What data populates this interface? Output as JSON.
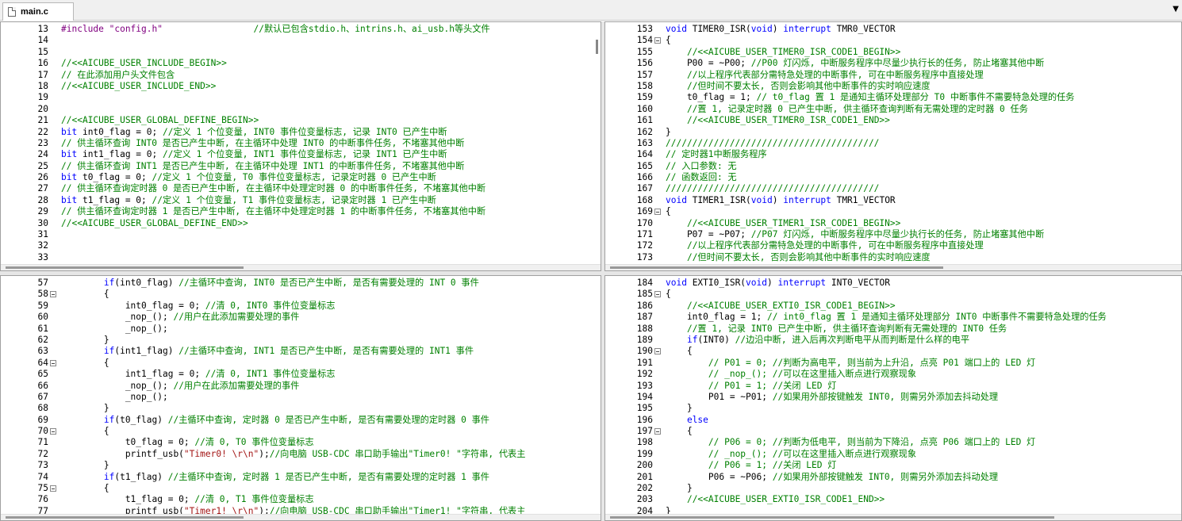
{
  "tab": {
    "label": "main.c"
  },
  "dropdown_glyph": "▼",
  "panes": [
    {
      "name": "pane-top-left",
      "lines": [
        {
          "n": "13",
          "segs": [
            [
              "pp",
              "#include \"config.h\""
            ],
            [
              "tx",
              "                 "
            ],
            [
              "cm",
              "//默认已包含stdio.h、intrins.h、ai_usb.h等头文件"
            ]
          ]
        },
        {
          "n": "14",
          "segs": []
        },
        {
          "n": "15",
          "segs": []
        },
        {
          "n": "16",
          "segs": [
            [
              "cm",
              "//<<AICUBE_USER_INCLUDE_BEGIN>>"
            ]
          ]
        },
        {
          "n": "17",
          "segs": [
            [
              "cm",
              "// 在此添加用户头文件包含"
            ]
          ]
        },
        {
          "n": "18",
          "segs": [
            [
              "cm",
              "//<<AICUBE_USER_INCLUDE_END>>"
            ]
          ]
        },
        {
          "n": "19",
          "segs": []
        },
        {
          "n": "20",
          "segs": []
        },
        {
          "n": "21",
          "segs": [
            [
              "cm",
              "//<<AICUBE_USER_GLOBAL_DEFINE_BEGIN>>"
            ]
          ]
        },
        {
          "n": "22",
          "segs": [
            [
              "kw",
              "bit"
            ],
            [
              "tx",
              " int0_flag = 0; "
            ],
            [
              "cm",
              "//定义 1 个位变量, INT0 事件位变量标志, 记录 INT0 已产生中断"
            ]
          ]
        },
        {
          "n": "23",
          "segs": [
            [
              "cm",
              "// 供主循环查询 INT0 是否已产生中断, 在主循环中处理 INT0 的中断事件任务, 不堵塞其他中断"
            ]
          ]
        },
        {
          "n": "24",
          "segs": [
            [
              "kw",
              "bit"
            ],
            [
              "tx",
              " int1_flag = 0; "
            ],
            [
              "cm",
              "//定义 1 个位变量, INT1 事件位变量标志, 记录 INT1 已产生中断"
            ]
          ]
        },
        {
          "n": "25",
          "segs": [
            [
              "cm",
              "// 供主循环查询 INT1 是否已产生中断, 在主循环中处理 INT1 的中断事件任务, 不堵塞其他中断"
            ]
          ]
        },
        {
          "n": "26",
          "segs": [
            [
              "kw",
              "bit"
            ],
            [
              "tx",
              " t0_flag = 0; "
            ],
            [
              "cm",
              "//定义 1 个位变量, T0 事件位变量标志, 记录定时器 0 已产生中断"
            ]
          ]
        },
        {
          "n": "27",
          "segs": [
            [
              "cm",
              "// 供主循环查询定时器 0 是否已产生中断, 在主循环中处理定时器 0 的中断事件任务, 不堵塞其他中断"
            ]
          ]
        },
        {
          "n": "28",
          "segs": [
            [
              "kw",
              "bit"
            ],
            [
              "tx",
              " t1_flag = 0; "
            ],
            [
              "cm",
              "//定义 1 个位变量, T1 事件位变量标志, 记录定时器 1 已产生中断"
            ]
          ]
        },
        {
          "n": "29",
          "segs": [
            [
              "cm",
              "// 供主循环查询定时器 1 是否已产生中断, 在主循环中处理定时器 1 的中断事件任务, 不堵塞其他中断"
            ]
          ]
        },
        {
          "n": "30",
          "segs": [
            [
              "cm",
              "//<<AICUBE_USER_GLOBAL_DEFINE_END>>"
            ]
          ]
        },
        {
          "n": "31",
          "segs": []
        },
        {
          "n": "32",
          "segs": []
        },
        {
          "n": "33",
          "segs": []
        }
      ]
    },
    {
      "name": "pane-top-right",
      "lines": [
        {
          "n": "153",
          "segs": [
            [
              "kw",
              "void"
            ],
            [
              "tx",
              " TIMER0_ISR("
            ],
            [
              "kw",
              "void"
            ],
            [
              "tx",
              ") "
            ],
            [
              "kw",
              "interrupt"
            ],
            [
              "tx",
              " TMR0_VECTOR"
            ]
          ]
        },
        {
          "n": "154",
          "fold": true,
          "segs": [
            [
              "tx",
              "{"
            ]
          ]
        },
        {
          "n": "155",
          "segs": [
            [
              "tx",
              "    "
            ],
            [
              "cm",
              "//<<AICUBE_USER_TIMER0_ISR_CODE1_BEGIN>>"
            ]
          ]
        },
        {
          "n": "156",
          "segs": [
            [
              "tx",
              "    P00 = ~P00; "
            ],
            [
              "cm",
              "//P00 灯闪烁, 中断服务程序中尽量少执行长的任务, 防止堵塞其他中断"
            ]
          ]
        },
        {
          "n": "157",
          "segs": [
            [
              "tx",
              "    "
            ],
            [
              "cm",
              "//以上程序代表部分需特急处理的中断事件, 可在中断服务程序中直接处理"
            ]
          ]
        },
        {
          "n": "158",
          "segs": [
            [
              "tx",
              "    "
            ],
            [
              "cm",
              "//但时间不要太长, 否则会影响其他中断事件的实时响应速度"
            ]
          ]
        },
        {
          "n": "159",
          "segs": [
            [
              "tx",
              "    t0_flag = 1; "
            ],
            [
              "cm",
              "// t0_flag 置 1 是通知主循环处理部分 T0 中断事件不需要特急处理的任务"
            ]
          ]
        },
        {
          "n": "160",
          "segs": [
            [
              "tx",
              "    "
            ],
            [
              "cm",
              "//置 1, 记录定时器 0 已产生中断, 供主循环查询判断有无需处理的定时器 0 任务"
            ]
          ]
        },
        {
          "n": "161",
          "segs": [
            [
              "tx",
              "    "
            ],
            [
              "cm",
              "//<<AICUBE_USER_TIMER0_ISR_CODE1_END>>"
            ]
          ]
        },
        {
          "n": "162",
          "segs": [
            [
              "tx",
              "}"
            ]
          ]
        },
        {
          "n": "163",
          "segs": [
            [
              "cm",
              "////////////////////////////////////////"
            ]
          ]
        },
        {
          "n": "164",
          "segs": [
            [
              "cm",
              "// 定时器1中断服务程序"
            ]
          ]
        },
        {
          "n": "165",
          "segs": [
            [
              "cm",
              "// 入口参数: 无"
            ]
          ]
        },
        {
          "n": "166",
          "segs": [
            [
              "cm",
              "// 函数返回: 无"
            ]
          ]
        },
        {
          "n": "167",
          "segs": [
            [
              "cm",
              "////////////////////////////////////////"
            ]
          ]
        },
        {
          "n": "168",
          "segs": [
            [
              "kw",
              "void"
            ],
            [
              "tx",
              " TIMER1_ISR("
            ],
            [
              "kw",
              "void"
            ],
            [
              "tx",
              ") "
            ],
            [
              "kw",
              "interrupt"
            ],
            [
              "tx",
              " TMR1_VECTOR"
            ]
          ]
        },
        {
          "n": "169",
          "fold": true,
          "segs": [
            [
              "tx",
              "{"
            ]
          ]
        },
        {
          "n": "170",
          "segs": [
            [
              "tx",
              "    "
            ],
            [
              "cm",
              "//<<AICUBE_USER_TIMER1_ISR_CODE1_BEGIN>>"
            ]
          ]
        },
        {
          "n": "171",
          "segs": [
            [
              "tx",
              "    P07 = ~P07; "
            ],
            [
              "cm",
              "//P07 灯闪烁, 中断服务程序中尽量少执行长的任务, 防止堵塞其他中断"
            ]
          ]
        },
        {
          "n": "172",
          "segs": [
            [
              "tx",
              "    "
            ],
            [
              "cm",
              "//以上程序代表部分需特急处理的中断事件, 可在中断服务程序中直接处理"
            ]
          ]
        },
        {
          "n": "173",
          "segs": [
            [
              "tx",
              "    "
            ],
            [
              "cm",
              "//但时间不要太长, 否则会影响其他中断事件的实时响应速度"
            ]
          ]
        }
      ]
    },
    {
      "name": "pane-bottom-left",
      "lines": [
        {
          "n": "57",
          "segs": [
            [
              "tx",
              "        "
            ],
            [
              "kw",
              "if"
            ],
            [
              "tx",
              "(int0_flag) "
            ],
            [
              "cm",
              "//主循环中查询, INT0 是否已产生中断, 是否有需要处理的 INT 0 事件"
            ]
          ]
        },
        {
          "n": "58",
          "fold": true,
          "segs": [
            [
              "tx",
              "        {"
            ]
          ]
        },
        {
          "n": "59",
          "segs": [
            [
              "tx",
              "            int0_flag = 0; "
            ],
            [
              "cm",
              "//清 0, INT0 事件位变量标志"
            ]
          ]
        },
        {
          "n": "60",
          "segs": [
            [
              "tx",
              "            _nop_(); "
            ],
            [
              "cm",
              "//用户在此添加需要处理的事件"
            ]
          ]
        },
        {
          "n": "61",
          "segs": [
            [
              "tx",
              "            _nop_();"
            ]
          ]
        },
        {
          "n": "62",
          "segs": [
            [
              "tx",
              "        }"
            ]
          ]
        },
        {
          "n": "63",
          "segs": [
            [
              "tx",
              "        "
            ],
            [
              "kw",
              "if"
            ],
            [
              "tx",
              "(int1_flag) "
            ],
            [
              "cm",
              "//主循环中查询, INT1 是否已产生中断, 是否有需要处理的 INT1 事件"
            ]
          ]
        },
        {
          "n": "64",
          "fold": true,
          "segs": [
            [
              "tx",
              "        {"
            ]
          ]
        },
        {
          "n": "65",
          "segs": [
            [
              "tx",
              "            int1_flag = 0; "
            ],
            [
              "cm",
              "//清 0, INT1 事件位变量标志"
            ]
          ]
        },
        {
          "n": "66",
          "segs": [
            [
              "tx",
              "            _nop_(); "
            ],
            [
              "cm",
              "//用户在此添加需要处理的事件"
            ]
          ]
        },
        {
          "n": "67",
          "segs": [
            [
              "tx",
              "            _nop_();"
            ]
          ]
        },
        {
          "n": "68",
          "segs": [
            [
              "tx",
              "        }"
            ]
          ]
        },
        {
          "n": "69",
          "segs": [
            [
              "tx",
              "        "
            ],
            [
              "kw",
              "if"
            ],
            [
              "tx",
              "(t0_flag) "
            ],
            [
              "cm",
              "//主循环中查询, 定时器 0 是否已产生中断, 是否有需要处理的定时器 0 事件"
            ]
          ]
        },
        {
          "n": "70",
          "fold": true,
          "segs": [
            [
              "tx",
              "        {"
            ]
          ]
        },
        {
          "n": "71",
          "segs": [
            [
              "tx",
              "            t0_flag = 0; "
            ],
            [
              "cm",
              "//清 0, T0 事件位变量标志"
            ]
          ]
        },
        {
          "n": "72",
          "segs": [
            [
              "tx",
              "            printf_usb("
            ],
            [
              "st",
              "\"Timer0! \\r\\n\""
            ],
            [
              "tx",
              ");"
            ],
            [
              "cm",
              "//向电脑 USB-CDC 串口助手输出\"Timer0! \"字符串, 代表主"
            ]
          ]
        },
        {
          "n": "73",
          "segs": [
            [
              "tx",
              "        }"
            ]
          ]
        },
        {
          "n": "74",
          "segs": [
            [
              "tx",
              "        "
            ],
            [
              "kw",
              "if"
            ],
            [
              "tx",
              "(t1_flag) "
            ],
            [
              "cm",
              "//主循环中查询, 定时器 1 是否已产生中断, 是否有需要处理的定时器 1 事件"
            ]
          ]
        },
        {
          "n": "75",
          "fold": true,
          "segs": [
            [
              "tx",
              "        {"
            ]
          ]
        },
        {
          "n": "76",
          "segs": [
            [
              "tx",
              "            t1_flag = 0; "
            ],
            [
              "cm",
              "//清 0, T1 事件位变量标志"
            ]
          ]
        },
        {
          "n": "77",
          "segs": [
            [
              "tx",
              "            printf_usb("
            ],
            [
              "st",
              "\"Timer1! \\r\\n\""
            ],
            [
              "tx",
              ");"
            ],
            [
              "cm",
              "//向电脑 USB-CDC 串口助手输出\"Timer1! \"字符串, 代表主"
            ]
          ]
        }
      ]
    },
    {
      "name": "pane-bottom-right",
      "lines": [
        {
          "n": "184",
          "segs": [
            [
              "kw",
              "void"
            ],
            [
              "tx",
              " EXTI0_ISR("
            ],
            [
              "kw",
              "void"
            ],
            [
              "tx",
              ") "
            ],
            [
              "kw",
              "interrupt"
            ],
            [
              "tx",
              " INT0_VECTOR"
            ]
          ]
        },
        {
          "n": "185",
          "fold": true,
          "segs": [
            [
              "tx",
              "{"
            ]
          ]
        },
        {
          "n": "186",
          "segs": [
            [
              "tx",
              "    "
            ],
            [
              "cm",
              "//<<AICUBE_USER_EXTI0_ISR_CODE1_BEGIN>>"
            ]
          ]
        },
        {
          "n": "187",
          "segs": [
            [
              "tx",
              "    int0_flag = 1; "
            ],
            [
              "cm",
              "// int0_flag 置 1 是通知主循环处理部分 INT0 中断事件不需要特急处理的任务"
            ]
          ]
        },
        {
          "n": "188",
          "segs": [
            [
              "tx",
              "    "
            ],
            [
              "cm",
              "//置 1, 记录 INT0 已产生中断, 供主循环查询判断有无需处理的 INT0 任务"
            ]
          ]
        },
        {
          "n": "189",
          "segs": [
            [
              "tx",
              "    "
            ],
            [
              "kw",
              "if"
            ],
            [
              "tx",
              "(INT0) "
            ],
            [
              "cm",
              "//边沿中断, 进入后再次判断电平从而判断是什么样的电平"
            ]
          ]
        },
        {
          "n": "190",
          "fold": true,
          "segs": [
            [
              "tx",
              "    {"
            ]
          ]
        },
        {
          "n": "191",
          "segs": [
            [
              "tx",
              "        "
            ],
            [
              "cm",
              "// P01 = 0; //判断为高电平, 则当前为上升沿, 点亮 P01 端口上的 LED 灯"
            ]
          ]
        },
        {
          "n": "192",
          "segs": [
            [
              "tx",
              "        "
            ],
            [
              "cm",
              "// _nop_(); //可以在这里插入断点进行观察现象"
            ]
          ]
        },
        {
          "n": "193",
          "segs": [
            [
              "tx",
              "        "
            ],
            [
              "cm",
              "// P01 = 1; //关闭 LED 灯"
            ]
          ]
        },
        {
          "n": "194",
          "segs": [
            [
              "tx",
              "        P01 = ~P01; "
            ],
            [
              "cm",
              "//如果用外部按键触发 INT0, 则需另外添加去抖动处理"
            ]
          ]
        },
        {
          "n": "195",
          "segs": [
            [
              "tx",
              "    }"
            ]
          ]
        },
        {
          "n": "196",
          "segs": [
            [
              "tx",
              "    "
            ],
            [
              "kw",
              "else"
            ]
          ]
        },
        {
          "n": "197",
          "fold": true,
          "segs": [
            [
              "tx",
              "    {"
            ]
          ]
        },
        {
          "n": "198",
          "segs": [
            [
              "tx",
              "        "
            ],
            [
              "cm",
              "// P06 = 0; //判断为低电平, 则当前为下降沿, 点亮 P06 端口上的 LED 灯"
            ]
          ]
        },
        {
          "n": "199",
          "segs": [
            [
              "tx",
              "        "
            ],
            [
              "cm",
              "// _nop_(); //可以在这里插入断点进行观察现象"
            ]
          ]
        },
        {
          "n": "200",
          "segs": [
            [
              "tx",
              "        "
            ],
            [
              "cm",
              "// P06 = 1; //关闭 LED 灯"
            ]
          ]
        },
        {
          "n": "201",
          "segs": [
            [
              "tx",
              "        P06 = ~P06; "
            ],
            [
              "cm",
              "//如果用外部按键触发 INT0, 则需另外添加去抖动处理"
            ]
          ]
        },
        {
          "n": "202",
          "segs": [
            [
              "tx",
              "    }"
            ]
          ]
        },
        {
          "n": "203",
          "segs": [
            [
              "tx",
              "    "
            ],
            [
              "cm",
              "//<<AICUBE_USER_EXTI0_ISR_CODE1_END>>"
            ]
          ]
        },
        {
          "n": "204",
          "segs": [
            [
              "tx",
              "}"
            ]
          ]
        }
      ]
    }
  ]
}
